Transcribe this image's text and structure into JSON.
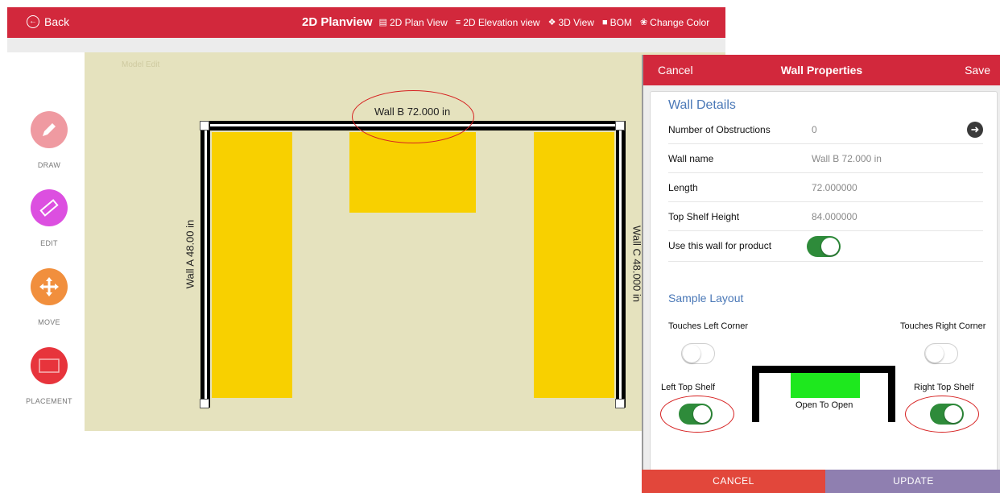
{
  "header": {
    "back_label": "Back",
    "back_icon": "arrow-left-circle-icon",
    "title": "2D Planview",
    "nav": [
      {
        "label": "2D Plan View",
        "icon": "plan-icon"
      },
      {
        "label": "2D Elevation view",
        "icon": "list-icon"
      },
      {
        "label": "3D View",
        "icon": "cube-icon"
      },
      {
        "label": "BOM",
        "icon": "document-icon"
      },
      {
        "label": "Change Color",
        "icon": "palette-icon"
      }
    ],
    "color": "#d2283c"
  },
  "toolbar": {
    "tools": [
      {
        "label": "DRAW",
        "icon": "pencil-icon",
        "color": "#ef9aa1"
      },
      {
        "label": "EDIT",
        "icon": "ruler-icon",
        "color": "#dc4fe0"
      },
      {
        "label": "MOVE",
        "icon": "move-arrows-icon",
        "color": "#f18f3d"
      },
      {
        "label": "PLACEMENT",
        "icon": "placement-icon",
        "color": "#e7343c"
      }
    ]
  },
  "canvas": {
    "mode_label": "Model Edit",
    "wall_a_label": "Wall A 48.00 in",
    "wall_b_label": "Wall B 72.000 in",
    "wall_c_label": "Wall C 48.000 in",
    "background": "#e5e2be",
    "cabinet_color": "#f8d000"
  },
  "panel": {
    "cancel_label": "Cancel",
    "title": "Wall Properties",
    "save_label": "Save",
    "wall_details_title": "Wall Details",
    "rows": [
      {
        "label": "Number of Obstructions",
        "value": "0"
      },
      {
        "label": "Wall name",
        "value": "Wall B 72.000 in"
      },
      {
        "label": "Length",
        "value": "72.000000"
      },
      {
        "label": "Top Shelf Height",
        "value": "84.000000"
      },
      {
        "label": "Use this wall for product",
        "value": ""
      }
    ],
    "use_wall_on": true,
    "sample_layout_title": "Sample Layout",
    "touches_left_label": "Touches Left Corner",
    "touches_right_label": "Touches Right Corner",
    "touches_left_on": false,
    "touches_right_on": false,
    "left_top_shelf_label": "Left Top Shelf",
    "right_top_shelf_label": "Right Top Shelf",
    "left_top_shelf_on": true,
    "right_top_shelf_on": true,
    "diagram_label": "Open To Open",
    "cancel_button": "CANCEL",
    "update_button": "UPDATE",
    "cancel_color": "#e2473b",
    "update_color": "#8f7fb0"
  }
}
